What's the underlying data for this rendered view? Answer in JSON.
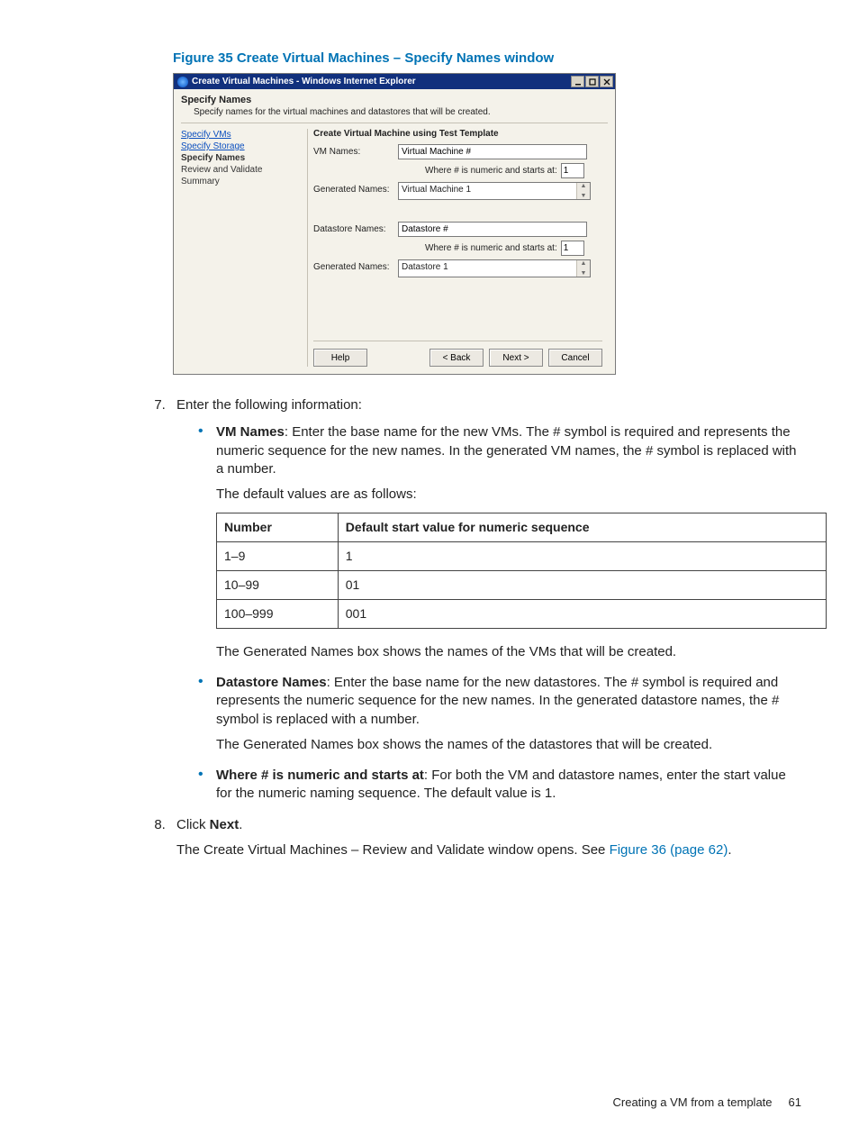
{
  "figure_caption": "Figure 35 Create Virtual Machines – Specify Names window",
  "window": {
    "title": "Create Virtual Machines - Windows Internet Explorer",
    "section_title": "Specify Names",
    "section_desc": "Specify names for the virtual machines and datastores that will be created.",
    "nav": {
      "specify_vms": "Specify VMs",
      "specify_storage": "Specify Storage",
      "specify_names": "Specify Names",
      "review_validate": "Review and Validate",
      "summary": "Summary"
    },
    "panel": {
      "heading": "Create Virtual Machine using Test Template",
      "vm_names_label": "VM Names:",
      "vm_names_value": "Virtual Machine #",
      "starts_at_label": "Where # is numeric and starts at:",
      "vm_starts_at_value": "1",
      "generated_label": "Generated Names:",
      "vm_generated_value": "Virtual Machine 1",
      "ds_names_label": "Datastore Names:",
      "ds_names_value": "Datastore #",
      "ds_starts_at_value": "1",
      "ds_generated_value": "Datastore 1"
    },
    "buttons": {
      "help": "Help",
      "back": "< Back",
      "next": "Next >",
      "cancel": "Cancel"
    }
  },
  "step7": {
    "number": "7.",
    "intro": "Enter the following information:",
    "vm_names_lead": "VM Names",
    "vm_names_text": ": Enter the base name for the new VMs. The # symbol is required and represents the numeric sequence for the new names. In the generated VM names, the # symbol is replaced with a number.",
    "default_values_text": "The default values are as follows:",
    "table": {
      "header_number": "Number",
      "header_default": "Default start value for numeric sequence",
      "rows": [
        {
          "number": "1–9",
          "value": "1"
        },
        {
          "number": "10–99",
          "value": "01"
        },
        {
          "number": "100–999",
          "value": "001"
        }
      ]
    },
    "generated_vm_text": "The Generated Names box shows the names of the VMs that will be created.",
    "ds_names_lead": "Datastore Names",
    "ds_names_text": ": Enter the base name for the new datastores. The # symbol is required and represents the numeric sequence for the new names. In the generated datastore names, the # symbol is replaced with a number.",
    "generated_ds_text": "The Generated Names box shows the names of the datastores that will be created.",
    "starts_at_lead": "Where # is numeric and starts at",
    "starts_at_text": ": For both the VM and datastore names, enter the start value for the numeric naming sequence. The default value is 1."
  },
  "step8": {
    "number": "8.",
    "click": "Click ",
    "next_bold": "Next",
    "period": ".",
    "result_pre": "The Create Virtual Machines – Review and Validate window opens. See ",
    "result_link": "Figure 36 (page 62)",
    "result_post": "."
  },
  "footer": {
    "text": "Creating a VM from a template",
    "page": "61"
  }
}
